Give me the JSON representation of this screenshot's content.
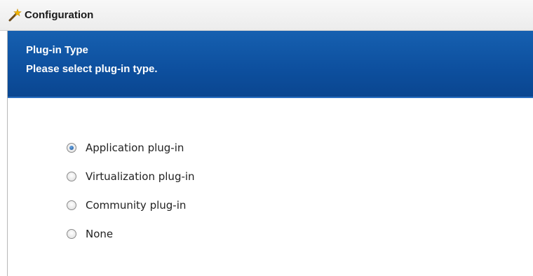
{
  "window": {
    "title": "Configuration",
    "title_icon": "wizard-wand-icon"
  },
  "banner": {
    "title": "Plug-in Type",
    "subtitle": "Please select plug-in type."
  },
  "plugin_type": {
    "selected": "Application plug-in",
    "options": [
      {
        "label": "Application plug-in",
        "checked": true
      },
      {
        "label": "Virtualization plug-in",
        "checked": false
      },
      {
        "label": "Community plug-in",
        "checked": false
      },
      {
        "label": "None",
        "checked": false
      }
    ]
  },
  "colors": {
    "banner": "#0d4f9e",
    "banner_text": "#ffffff",
    "titlebar": "#f0f0f0"
  }
}
